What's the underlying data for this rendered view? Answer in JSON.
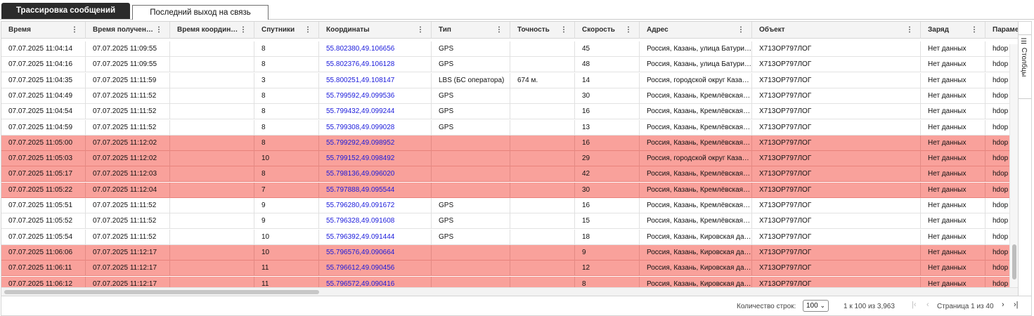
{
  "tabs": {
    "active": "Трассировка сообщений",
    "inactive": "Последний выход на связь"
  },
  "columns": [
    {
      "label": "Время"
    },
    {
      "label": "Время получен…"
    },
    {
      "label": "Время координ…"
    },
    {
      "label": "Спутники"
    },
    {
      "label": "Координаты"
    },
    {
      "label": "Тип"
    },
    {
      "label": "Точность"
    },
    {
      "label": "Скорость"
    },
    {
      "label": "Адрес"
    },
    {
      "label": "Объект"
    },
    {
      "label": "Заряд"
    },
    {
      "label": "Параме"
    }
  ],
  "kebab_glyph": "⋮",
  "rows": [
    {
      "alert": false,
      "cells": [
        "07.07.2025 11:04:14",
        "07.07.2025 11:09:55",
        "",
        "8",
        "55.802380,49.106656",
        "GPS",
        "",
        "45",
        "Россия, Казань, улица Батурина…",
        "X713OP797ЛОГ",
        "Нет данных",
        "hdop"
      ]
    },
    {
      "alert": false,
      "cells": [
        "07.07.2025 11:04:16",
        "07.07.2025 11:09:55",
        "",
        "8",
        "55.802376,49.106128",
        "GPS",
        "",
        "48",
        "Россия, Казань, улица Батурина…",
        "X713OP797ЛОГ",
        "Нет данных",
        "hdop"
      ]
    },
    {
      "alert": false,
      "cells": [
        "07.07.2025 11:04:35",
        "07.07.2025 11:11:59",
        "",
        "3",
        "55.800251,49.108147",
        "LBS (БС оператора)",
        "674 м.",
        "14",
        "Россия, городской округ Казань…",
        "X713OP797ЛОГ",
        "Нет данных",
        "hdop"
      ]
    },
    {
      "alert": false,
      "cells": [
        "07.07.2025 11:04:49",
        "07.07.2025 11:11:52",
        "",
        "8",
        "55.799592,49.099536",
        "GPS",
        "",
        "30",
        "Россия, Казань, Кремлёвская улица",
        "X713OP797ЛОГ",
        "Нет данных",
        "hdop"
      ]
    },
    {
      "alert": false,
      "cells": [
        "07.07.2025 11:04:54",
        "07.07.2025 11:11:52",
        "",
        "8",
        "55.799432,49.099244",
        "GPS",
        "",
        "16",
        "Россия, Казань, Кремлёвская улица",
        "X713OP797ЛОГ",
        "Нет данных",
        "hdop"
      ]
    },
    {
      "alert": false,
      "cells": [
        "07.07.2025 11:04:59",
        "07.07.2025 11:11:52",
        "",
        "8",
        "55.799308,49.099028",
        "GPS",
        "",
        "13",
        "Россия, Казань, Кремлёвская улица",
        "X713OP797ЛОГ",
        "Нет данных",
        "hdop"
      ]
    },
    {
      "alert": true,
      "cells": [
        "07.07.2025 11:05:00",
        "07.07.2025 11:12:02",
        "",
        "8",
        "55.799292,49.098952",
        "",
        "",
        "16",
        "Россия, Казань, Кремлёвская улица",
        "X713OP797ЛОГ",
        "Нет данных",
        "hdop"
      ]
    },
    {
      "alert": true,
      "cells": [
        "07.07.2025 11:05:03",
        "07.07.2025 11:12:02",
        "",
        "10",
        "55.799152,49.098492",
        "",
        "",
        "29",
        "Россия, городской округ Казань…",
        "X713OP797ЛОГ",
        "Нет данных",
        "hdop"
      ]
    },
    {
      "alert": true,
      "cells": [
        "07.07.2025 11:05:17",
        "07.07.2025 11:12:03",
        "",
        "8",
        "55.798136,49.096020",
        "",
        "",
        "42",
        "Россия, Казань, Кремлёвская улица",
        "X713OP797ЛОГ",
        "Нет данных",
        "hdop"
      ]
    },
    {
      "alert": true,
      "cells": [
        "07.07.2025 11:05:22",
        "07.07.2025 11:12:04",
        "",
        "7",
        "55.797888,49.095544",
        "",
        "",
        "30",
        "Россия, Казань, Кремлёвская улица",
        "X713OP797ЛОГ",
        "Нет данных",
        "hdop"
      ]
    },
    {
      "alert": false,
      "cells": [
        "07.07.2025 11:05:51",
        "07.07.2025 11:11:52",
        "",
        "9",
        "55.796280,49.091672",
        "GPS",
        "",
        "16",
        "Россия, Казань, Кремлёвская улица",
        "X713OP797ЛОГ",
        "Нет данных",
        "hdop"
      ]
    },
    {
      "alert": false,
      "cells": [
        "07.07.2025 11:05:52",
        "07.07.2025 11:11:52",
        "",
        "9",
        "55.796328,49.091608",
        "GPS",
        "",
        "15",
        "Россия, Казань, Кремлёвская улица",
        "X713OP797ЛОГ",
        "Нет данных",
        "hdop"
      ]
    },
    {
      "alert": false,
      "cells": [
        "07.07.2025 11:05:54",
        "07.07.2025 11:11:52",
        "",
        "10",
        "55.796392,49.091444",
        "GPS",
        "",
        "18",
        "Россия, Казань, Кировская дамба",
        "X713OP797ЛОГ",
        "Нет данных",
        "hdop"
      ]
    },
    {
      "alert": true,
      "cells": [
        "07.07.2025 11:06:06",
        "07.07.2025 11:12:17",
        "",
        "10",
        "55.796576,49.090664",
        "",
        "",
        "9",
        "Россия, Казань, Кировская дамба",
        "X713OP797ЛОГ",
        "Нет данных",
        "hdop"
      ]
    },
    {
      "alert": true,
      "cells": [
        "07.07.2025 11:06:11",
        "07.07.2025 11:12:17",
        "",
        "11",
        "55.796612,49.090456",
        "",
        "",
        "12",
        "Россия, Казань, Кировская дамба",
        "X713OP797ЛОГ",
        "Нет данных",
        "hdop"
      ]
    },
    {
      "alert": true,
      "cells": [
        "07.07.2025 11:06:12",
        "07.07.2025 11:12:17",
        "",
        "11",
        "55.796572,49.090416",
        "",
        "",
        "8",
        "Россия, Казань, Кировская дамба",
        "X713OP797ЛОГ",
        "Нет данных",
        "hdop"
      ]
    }
  ],
  "side_panel": {
    "label": "Столбцы",
    "icon": "columns-icon"
  },
  "footer": {
    "rows_label": "Количество строк:",
    "rows_value": "100",
    "range": "1 к 100 из 3,963",
    "page": "Страница 1 из 40"
  },
  "colors": {
    "alert_row": "#f9a19b",
    "coord_link": "#1a1adb",
    "active_tab": "#2b2b2b"
  }
}
